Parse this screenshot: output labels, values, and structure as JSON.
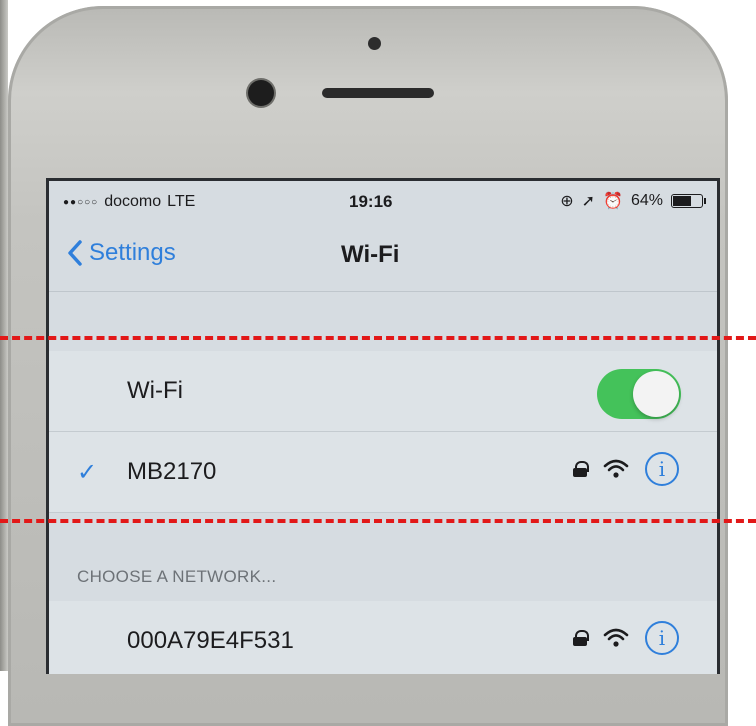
{
  "status_bar": {
    "carrier": "docomo",
    "network": "LTE",
    "time": "19:16",
    "battery": "64%",
    "battery_level": 0.64
  },
  "nav": {
    "back_label": "Settings",
    "title": "Wi-Fi"
  },
  "wifi_toggle": {
    "label": "Wi-Fi",
    "on": true
  },
  "connected_network": {
    "name": "MB2170",
    "secured": true
  },
  "section_header": "CHOOSE A NETWORK...",
  "networks": [
    {
      "name": "000A79E4F531",
      "secured": true
    }
  ],
  "colors": {
    "accent": "#2f7fdb",
    "toggle_on": "#44c25a",
    "highlight_dash": "#e21818"
  }
}
